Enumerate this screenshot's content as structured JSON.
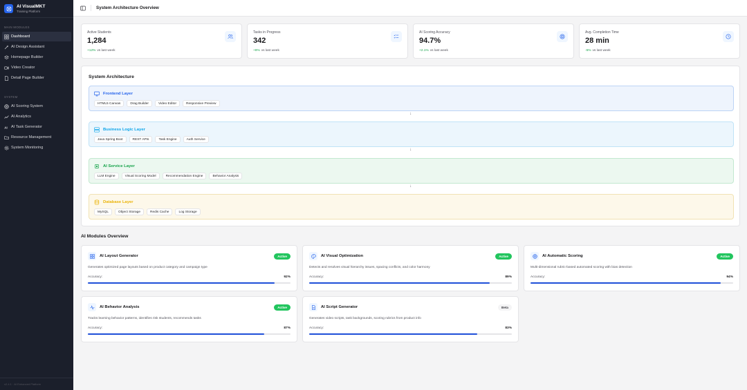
{
  "sidebar": {
    "brand_title": "AI VisualMKT",
    "brand_subtitle": "Training Platform",
    "section_main": "MAIN MODULES",
    "main_items": [
      {
        "label": "Dashboard",
        "icon": "grid-icon",
        "active": true
      },
      {
        "label": "AI Design Assistant",
        "icon": "wand-icon",
        "active": false
      },
      {
        "label": "Homepage Builder",
        "icon": "layers-icon",
        "active": false
      },
      {
        "label": "Video Creator",
        "icon": "video-icon",
        "active": false
      },
      {
        "label": "Detail Page Builder",
        "icon": "file-icon",
        "active": false
      }
    ],
    "section_system": "SYSTEM",
    "system_items": [
      {
        "label": "AI Scoring System",
        "icon": "target-icon"
      },
      {
        "label": "AI Analytics",
        "icon": "chart-icon"
      },
      {
        "label": "AI Task Generator",
        "icon": "ai-icon"
      },
      {
        "label": "Resource Management",
        "icon": "folder-icon"
      },
      {
        "label": "System Monitoring",
        "icon": "gear-icon"
      }
    ],
    "footer": "v2.4.1 · AI Enhanced Platform"
  },
  "topbar": {
    "title": "System Architecture Overview"
  },
  "stats": [
    {
      "label": "Active Students",
      "value": "1,284",
      "delta": "+12%",
      "suffix": "vs last week",
      "icon": "users-icon"
    },
    {
      "label": "Tasks in Progress",
      "value": "342",
      "delta": "+8%",
      "suffix": "vs last week",
      "icon": "list-check-icon"
    },
    {
      "label": "AI Scoring Accuracy",
      "value": "94.7%",
      "delta": "+2.1%",
      "suffix": "vs last week",
      "icon": "target-icon"
    },
    {
      "label": "Avg. Completion Time",
      "value": "28 min",
      "delta": "-5%",
      "suffix": "vs last week",
      "icon": "clock-icon"
    }
  ],
  "architecture": {
    "title": "System Architecture",
    "layers": [
      {
        "name": "Frontend Layer",
        "icon": "monitor-icon",
        "tags": [
          "HTML5 Canvas",
          "Drag Builder",
          "Video Editor",
          "Responsive Preview"
        ],
        "color": "#2563eb",
        "bg": "#eef4fd",
        "border": "#bcd3f5"
      },
      {
        "name": "Business Logic Layer",
        "icon": "server-icon",
        "tags": [
          "Java Spring Boot",
          "REST APIs",
          "Task Engine",
          "Auth Service"
        ],
        "color": "#0ea5e9",
        "bg": "#ecf6fd",
        "border": "#bfe3f7"
      },
      {
        "name": "AI Service Layer",
        "icon": "cpu-icon",
        "tags": [
          "LLM Engine",
          "Visual Scoring Model",
          "Recommendation Engine",
          "Behavior Analysis"
        ],
        "color": "#16a34a",
        "bg": "#ecf8f0",
        "border": "#c2e8cf"
      },
      {
        "name": "Database Layer",
        "icon": "database-icon",
        "tags": [
          "MySQL",
          "Object Storage",
          "Redis Cache",
          "Log Storage"
        ],
        "color": "#eab308",
        "bg": "#fdf8ea",
        "border": "#f1e2b3"
      }
    ],
    "arrow_glyph": "↓"
  },
  "modules": {
    "title": "AI Modules Overview",
    "accuracy_label": "Accuracy:",
    "items": [
      {
        "name": "AI Layout Generator",
        "icon": "layout-grid-icon",
        "badge": "Active",
        "badge_type": "active",
        "desc": "Generates optimized page layouts based on product category and campaign type",
        "accuracy": "92%",
        "accuracy_value": 0.92
      },
      {
        "name": "AI Visual Optimization",
        "icon": "palette-icon",
        "badge": "Active",
        "badge_type": "active",
        "desc": "Detects and resolves visual hierarchy issues, spacing conflicts, and color harmony",
        "accuracy": "89%",
        "accuracy_value": 0.89
      },
      {
        "name": "AI Automatic Scoring",
        "icon": "target-icon",
        "badge": "Active",
        "badge_type": "active",
        "desc": "Multi-dimensional rubric-based automated scoring with bias detection",
        "accuracy": "94%",
        "accuracy_value": 0.94
      },
      {
        "name": "AI Behavior Analysis",
        "icon": "activity-icon",
        "badge": "Active",
        "badge_type": "active",
        "desc": "Tracks learning behavior patterns, identifies risk students, recommends tasks",
        "accuracy": "87%",
        "accuracy_value": 0.87
      },
      {
        "name": "AI Script Generator",
        "icon": "document-icon",
        "badge": "Beta",
        "badge_type": "beta",
        "desc": "Generates video scripts, task backgrounds, scoring rubrics from product info",
        "accuracy": "83%",
        "accuracy_value": 0.83
      }
    ]
  },
  "colors": {
    "accent": "#2563eb",
    "sidebar_bg": "#1b1f2b",
    "success": "#22c55e"
  }
}
